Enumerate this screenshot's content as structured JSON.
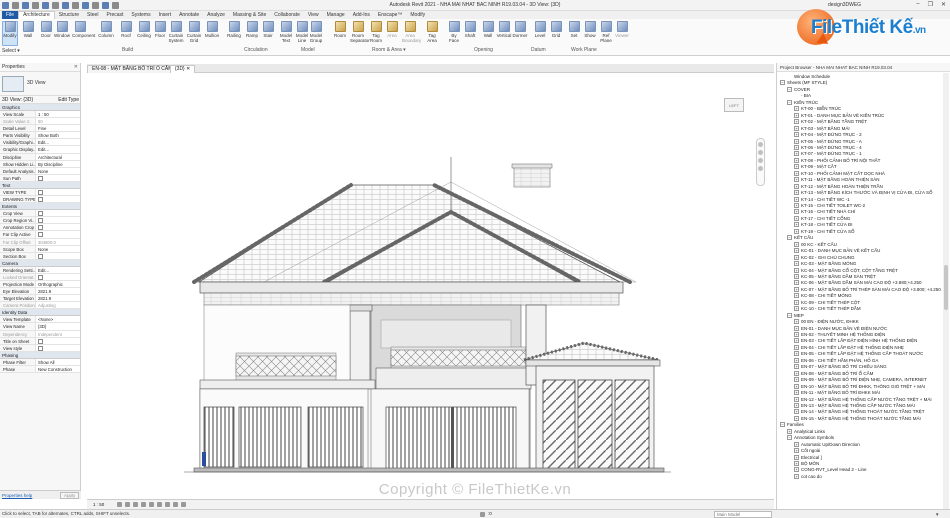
{
  "window": {
    "title": "Autodesk Revit 2021 - NHA MAI NHAT BAC NINH R19.03.04 - 3D View: {3D}",
    "user": "design3DWEG",
    "controls": [
      "–",
      "❐",
      "✕"
    ]
  },
  "menu_tabs": [
    "File",
    "Architecture",
    "Structure",
    "Steel",
    "Precast",
    "Systems",
    "Insert",
    "Annotate",
    "Analyze",
    "Massing & Site",
    "Collaborate",
    "View",
    "Manage",
    "Add-Ins",
    "Enscape™",
    "Modify"
  ],
  "active_tab": "Architecture",
  "ribbon": {
    "select": "Select ▾",
    "buttons": [
      {
        "label": "Modify",
        "icon": "modify-icon"
      },
      {
        "label": "Wall",
        "icon": "wall-icon"
      },
      {
        "label": "Door",
        "icon": "door-icon"
      },
      {
        "label": "Window",
        "icon": "window-icon"
      },
      {
        "label": "Component",
        "icon": "component-icon"
      },
      {
        "label": "Column",
        "icon": "column-icon"
      },
      {
        "label": "Roof",
        "icon": "roof-icon"
      },
      {
        "label": "Ceiling",
        "icon": "ceiling-icon"
      },
      {
        "label": "Floor",
        "icon": "floor-icon"
      },
      {
        "label": "Curtain System",
        "icon": "curtain-system-icon"
      },
      {
        "label": "Curtain Grid",
        "icon": "curtain-grid-icon"
      },
      {
        "label": "Mullion",
        "icon": "mullion-icon"
      },
      {
        "label": "Railing",
        "icon": "railing-icon"
      },
      {
        "label": "Ramp",
        "icon": "ramp-icon"
      },
      {
        "label": "Stair",
        "icon": "stair-icon"
      },
      {
        "label": "Model Text",
        "icon": "model-text-icon"
      },
      {
        "label": "Model Line",
        "icon": "model-line-icon"
      },
      {
        "label": "Model Group",
        "icon": "model-group-icon"
      },
      {
        "label": "Room",
        "icon": "room-icon"
      },
      {
        "label": "Room Separator",
        "icon": "room-separator-icon"
      },
      {
        "label": "Tag Room",
        "icon": "tag-room-icon"
      },
      {
        "label": "Area",
        "icon": "area-icon"
      },
      {
        "label": "Area Boundary",
        "icon": "area-boundary-icon"
      },
      {
        "label": "Tag Area",
        "icon": "tag-area-icon"
      },
      {
        "label": "By Face",
        "icon": "by-face-icon"
      },
      {
        "label": "Shaft",
        "icon": "shaft-icon"
      },
      {
        "label": "Wall",
        "icon": "wall-opening-icon"
      },
      {
        "label": "Vertical",
        "icon": "vertical-opening-icon"
      },
      {
        "label": "Dormer",
        "icon": "dormer-icon"
      },
      {
        "label": "Level",
        "icon": "level-icon"
      },
      {
        "label": "Grid",
        "icon": "grid-icon"
      },
      {
        "label": "Set",
        "icon": "set-workplane-icon"
      },
      {
        "label": "Show",
        "icon": "show-workplane-icon"
      },
      {
        "label": "Ref Plane",
        "icon": "ref-plane-icon"
      },
      {
        "label": "Viewer",
        "icon": "viewer-icon"
      }
    ],
    "groups": [
      "Build",
      "Circulation",
      "Model",
      "Room & Area ▾",
      "Opening",
      "Datum",
      "Work Plane"
    ]
  },
  "properties": {
    "title": "Properties",
    "type_name": "3D View",
    "dropdown": "3D View: {3D}",
    "edit_type": "Edit Type",
    "sections": [
      {
        "name": "Graphics",
        "rows": [
          [
            "View Scale",
            "1 : 50"
          ],
          [
            "Scale Value  1:",
            "50"
          ],
          [
            "Detail Level",
            "Fine"
          ],
          [
            "Parts Visibility",
            "Show Both"
          ],
          [
            "Visibility/Graphi...",
            "Edit..."
          ],
          [
            "Graphic Display...",
            "Edit..."
          ],
          [
            "Discipline",
            "Architectural"
          ],
          [
            "Show Hidden Li...",
            "By Discipline"
          ],
          [
            "Default Analysis...",
            "None"
          ],
          [
            "Sun Path",
            ""
          ]
        ]
      },
      {
        "name": "Text",
        "rows": [
          [
            "VIEW TYPE",
            ""
          ],
          [
            "DRAWING TYPE",
            ""
          ]
        ]
      },
      {
        "name": "Extents",
        "rows": [
          [
            "Crop View",
            ""
          ],
          [
            "Crop Region Vi...",
            ""
          ],
          [
            "Annotation Crop",
            ""
          ],
          [
            "Far Clip Active",
            ""
          ],
          [
            "Far Clip Offset",
            "304800.0"
          ],
          [
            "Scope Box",
            "None"
          ],
          [
            "Section Box",
            ""
          ]
        ]
      },
      {
        "name": "Camera",
        "rows": [
          [
            "Rendering Setti...",
            "Edit..."
          ],
          [
            "Locked Orientat...",
            ""
          ],
          [
            "Projection Mode",
            "Orthographic"
          ],
          [
            "Eye Elevation",
            "2821.9"
          ],
          [
            "Target Elevation",
            "2821.9"
          ],
          [
            "Camera Position",
            "Adjusting"
          ]
        ]
      },
      {
        "name": "Identity Data",
        "rows": [
          [
            "View Template",
            "<None>"
          ],
          [
            "View Name",
            "{3D}"
          ],
          [
            "Dependency",
            "Independent"
          ],
          [
            "Title on Sheet",
            ""
          ],
          [
            "View style",
            ""
          ]
        ]
      },
      {
        "name": "Phasing",
        "rows": [
          [
            "Phase Filter",
            "Show All"
          ],
          [
            "Phase",
            "New Construction"
          ]
        ]
      }
    ],
    "help": "Properties help",
    "apply": "Apply"
  },
  "view_tabs": [
    "EN-08 - MẶT BẰNG BỐ TRÍ Ổ CẮM",
    "{3D}"
  ],
  "viewcube": "LEFT",
  "project_browser": {
    "title": "Project Browser - NHA MAI NHAT BAC NINH R19.03.04",
    "items": [
      {
        "t": "Window Schedule",
        "lvl": 2,
        "ex": ""
      },
      {
        "t": "Sheets (MF STYLE)",
        "lvl": 0,
        "ex": "−"
      },
      {
        "t": "COVER",
        "lvl": 1,
        "ex": "−"
      },
      {
        "t": "- BIA",
        "lvl": 3,
        "ex": ""
      },
      {
        "t": "KIẾN TRÚC",
        "lvl": 1,
        "ex": "−"
      },
      {
        "t": "KT-00 - BIỂN TRÚC",
        "lvl": 2,
        "ex": "+"
      },
      {
        "t": "KT-01 - DANH MỤC BẢN VẼ KIẾN TRÚC",
        "lvl": 2,
        "ex": "+"
      },
      {
        "t": "KT-02 - MẶT BẰNG TẦNG TRỆT",
        "lvl": 2,
        "ex": "+"
      },
      {
        "t": "KT-03 - MẶT BẰNG MÁI",
        "lvl": 2,
        "ex": "+"
      },
      {
        "t": "KT-04 - MẶT ĐỨNG TRỤC - 2",
        "lvl": 2,
        "ex": "+"
      },
      {
        "t": "KT-05 - MẶT ĐỨNG TRỤC - A",
        "lvl": 2,
        "ex": "+"
      },
      {
        "t": "KT-06 - MẶT ĐỨNG TRỤC - 4",
        "lvl": 2,
        "ex": "+"
      },
      {
        "t": "KT-07 - MẶT ĐỨNG TRỤC - 1",
        "lvl": 2,
        "ex": "+"
      },
      {
        "t": "KT-08 - PHỐI CẢNH BỐ TRÍ NỘI THẤT",
        "lvl": 2,
        "ex": "+"
      },
      {
        "t": "KT-09 - MẶT CẮT",
        "lvl": 2,
        "ex": "+"
      },
      {
        "t": "KT-10 - PHỐI CẢNH MẶT CẮT DỌC NHÀ",
        "lvl": 2,
        "ex": "+"
      },
      {
        "t": "KT-11 - MẶT BẰNG HOÀN THIỆN SÀN",
        "lvl": 2,
        "ex": "+"
      },
      {
        "t": "KT-12 - MẶT BẰNG HOÀN THIỆN TRẦN",
        "lvl": 2,
        "ex": "+"
      },
      {
        "t": "KT-13 - MẶT BẰNG KÍCH THƯỚC VÀ ĐỊNH VỊ CỬA ĐI, CỬA SỔ",
        "lvl": 2,
        "ex": "+"
      },
      {
        "t": "KT-14 - CHI TIẾT WC -1",
        "lvl": 2,
        "ex": "+"
      },
      {
        "t": "KT-15 - CHI TIẾT TOILET WC-2",
        "lvl": 2,
        "ex": "+"
      },
      {
        "t": "KT-16 - CHI TIẾT NHÀ CHÍ",
        "lvl": 2,
        "ex": "+"
      },
      {
        "t": "KT-17 - CHI TIẾT CỔNG",
        "lvl": 2,
        "ex": "+"
      },
      {
        "t": "KT-18 - CHI TIẾT CỬA ĐI",
        "lvl": 2,
        "ex": "+"
      },
      {
        "t": "KT-19 - CHI TIẾT CỬA SỔ",
        "lvl": 2,
        "ex": "+"
      },
      {
        "t": "KẾT CẤU",
        "lvl": 1,
        "ex": "−"
      },
      {
        "t": "00 KC - KẾT CẤU",
        "lvl": 2,
        "ex": "+"
      },
      {
        "t": "KC-01 - DANH MỤC BẢN VẼ KẾT CẤU",
        "lvl": 2,
        "ex": "+"
      },
      {
        "t": "KC-02 - GHI CHÚ CHUNG",
        "lvl": 2,
        "ex": "+"
      },
      {
        "t": "KC-03 - MẶT BẰNG MÓNG",
        "lvl": 2,
        "ex": "+"
      },
      {
        "t": "KC-04 - MẶT BẰNG CỔ CỘT, CỘT TẦNG TRỆT",
        "lvl": 2,
        "ex": "+"
      },
      {
        "t": "KC-05 - MẶT BẰNG DẦM SÀN TRỆT",
        "lvl": 2,
        "ex": "+"
      },
      {
        "t": "KC-06 - MẶT BẰNG DẦM SÀN MÁI CAO ĐỘ +3.880;+4.250",
        "lvl": 2,
        "ex": "+"
      },
      {
        "t": "KC-07 - MẶT BẰNG BỐ TRÍ THÉP SÀN MÁI CAO ĐỘ +3.800; +4.250",
        "lvl": 2,
        "ex": "+"
      },
      {
        "t": "KC-08 - CHI TIẾT MÓNG",
        "lvl": 2,
        "ex": "+"
      },
      {
        "t": "KC-09 - CHI TIẾT THÉP CỘT",
        "lvl": 2,
        "ex": "+"
      },
      {
        "t": "KC-10 - CHI TIẾT THÉP DẦM",
        "lvl": 2,
        "ex": "+"
      },
      {
        "t": "MEP",
        "lvl": 1,
        "ex": "−"
      },
      {
        "t": "00 EN - ĐIỆN NƯỚC, ĐHKK",
        "lvl": 2,
        "ex": "+"
      },
      {
        "t": "EN-01 - DANH MỤC BẢN VẼ ĐIỆN NƯỚC",
        "lvl": 2,
        "ex": "+"
      },
      {
        "t": "EN-02 - THUYẾT MINH HỆ THỐNG ĐIỆN",
        "lvl": 2,
        "ex": "+"
      },
      {
        "t": "EN-03 - CHI TIẾT LẮP ĐẶT ĐIỆN HÌNH HỆ THỐNG ĐIỆN",
        "lvl": 2,
        "ex": "+"
      },
      {
        "t": "EN-04 - CHI TIẾT LẮP ĐẶT HỆ THỐNG ĐIỆN NHẸ",
        "lvl": 2,
        "ex": "+"
      },
      {
        "t": "EN-05 - CHI TIẾT LẮP ĐẶT HỆ THỐNG CẤP THOÁT NƯỚC",
        "lvl": 2,
        "ex": "+"
      },
      {
        "t": "EN-06 - CHI TIẾT HẦM PHÂN, HỐ GA",
        "lvl": 2,
        "ex": "+"
      },
      {
        "t": "EN-07 - MẶT BẰNG BỐ TRÍ CHIẾU SÁNG",
        "lvl": 2,
        "ex": "+"
      },
      {
        "t": "EN-08 - MẶT BẰNG BỐ TRÍ Ổ CẮM",
        "lvl": 2,
        "ex": "+"
      },
      {
        "t": "EN-09 - MẶT BẰNG BỐ TRÍ ĐIỆN NHẸ, CAMERA, INTERNET",
        "lvl": 2,
        "ex": "+"
      },
      {
        "t": "EN-10 - MẶT BẰNG BỐ TRÍ ĐHKK, THÔNG GIÓ TRỆT + MÁI",
        "lvl": 2,
        "ex": "+"
      },
      {
        "t": "EN-11 - MẶT BẰNG BỐ TRÍ ĐHKK MÁI",
        "lvl": 2,
        "ex": "+"
      },
      {
        "t": "EN-12 - MẶT BẰNG HỆ THỐNG CẤP NƯỚC TẦNG TRỆT + MÁI",
        "lvl": 2,
        "ex": "+"
      },
      {
        "t": "EN-13 - MẶT BẰNG HỆ THỐNG CẤP NƯỚC TẦNG MÁI",
        "lvl": 2,
        "ex": "+"
      },
      {
        "t": "EN-14 - MẶT BẰNG HỆ THỐNG THOÁT NƯỚC TẦNG TRỆT",
        "lvl": 2,
        "ex": "+"
      },
      {
        "t": "EN-15 - MẶT BẰNG HỆ THỐNG THOÁT NƯỚC TẦNG MÁI",
        "lvl": 2,
        "ex": "+"
      },
      {
        "t": "Families",
        "lvl": 0,
        "ex": "−"
      },
      {
        "t": "Analytical Links",
        "lvl": 1,
        "ex": "+"
      },
      {
        "t": "Annotation Symbols",
        "lvl": 1,
        "ex": "−"
      },
      {
        "t": "Automatic Up/Down Direction",
        "lvl": 2,
        "ex": "+"
      },
      {
        "t": "Cốt ngoài",
        "lvl": 2,
        "ex": "+"
      },
      {
        "t": "Electrical ]",
        "lvl": 2,
        "ex": "+"
      },
      {
        "t": "BỘ MÔN",
        "lvl": 2,
        "ex": "+"
      },
      {
        "t": "CONG-RVT_Level Head 2 - Line",
        "lvl": 2,
        "ex": "+"
      },
      {
        "t": "cot cao do",
        "lvl": 2,
        "ex": "+"
      }
    ]
  },
  "view_bar": {
    "scale": "1 : 50"
  },
  "status": {
    "text": "Click to select, TAB for alternates, CTRL adds, SHIFT unselects.",
    "model": "Main Model",
    "zero": ":0"
  },
  "watermark": "Copyright © FileThietKe.vn",
  "logo": {
    "brand": "FileThiết Kế",
    "tld": ".vn"
  },
  "colors": {
    "accent": "#1b7fd0",
    "logo_orange": "#e8580c"
  }
}
